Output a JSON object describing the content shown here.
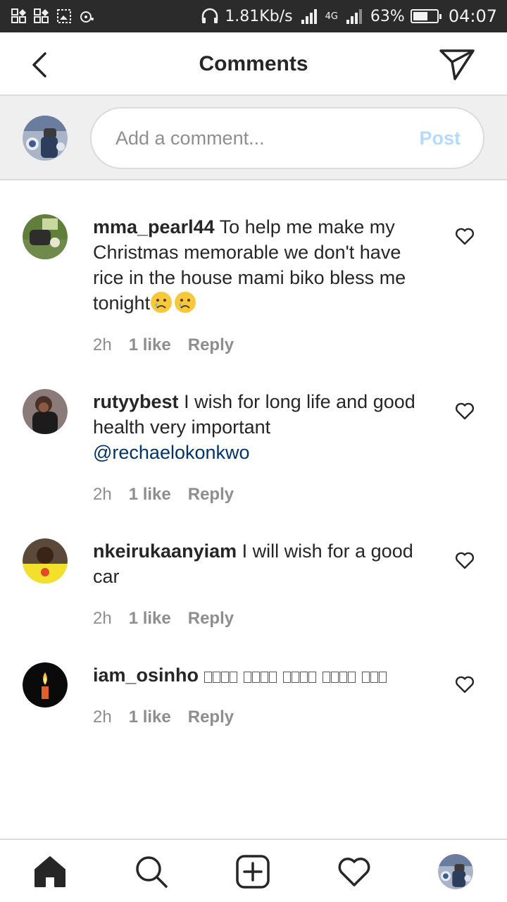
{
  "status_bar": {
    "speed": "1.81Kb/s",
    "network_label": "4G",
    "battery_percent": "63%",
    "battery_level": 0.63,
    "time": "04:07"
  },
  "header": {
    "title": "Comments",
    "icons": [
      "back-arrow-icon",
      "direct-send-icon"
    ]
  },
  "composer": {
    "placeholder": "Add a comment...",
    "post_label": "Post"
  },
  "comments": [
    {
      "username": "mma_pearl44",
      "text": "To help me make my Christmas memorable we don't have rice in the house mami biko bless me tonight",
      "emoji": "crying-face x2",
      "time": "2h",
      "likes": "1 like",
      "reply": "Reply"
    },
    {
      "username": "rutyybest",
      "text": "I wish for long life and good health very important",
      "mention": "@rechaelokonkwo",
      "time": "2h",
      "likes": "1 like",
      "reply": "Reply"
    },
    {
      "username": "nkeirukaanyiam",
      "text": "I will wish for a good car",
      "time": "2h",
      "likes": "1 like",
      "reply": "Reply"
    },
    {
      "username": "iam_osinho",
      "text": "",
      "time": "2h",
      "likes": "1 like",
      "reply": "Reply"
    }
  ],
  "bottom_nav": [
    "home-icon",
    "search-icon",
    "new-post-icon",
    "activity-heart-icon",
    "profile-avatar"
  ],
  "colors": {
    "post_disabled": "#b3dbff",
    "mention": "#003569",
    "meta": "#8e8e8e",
    "composer_bg": "#efefef"
  }
}
